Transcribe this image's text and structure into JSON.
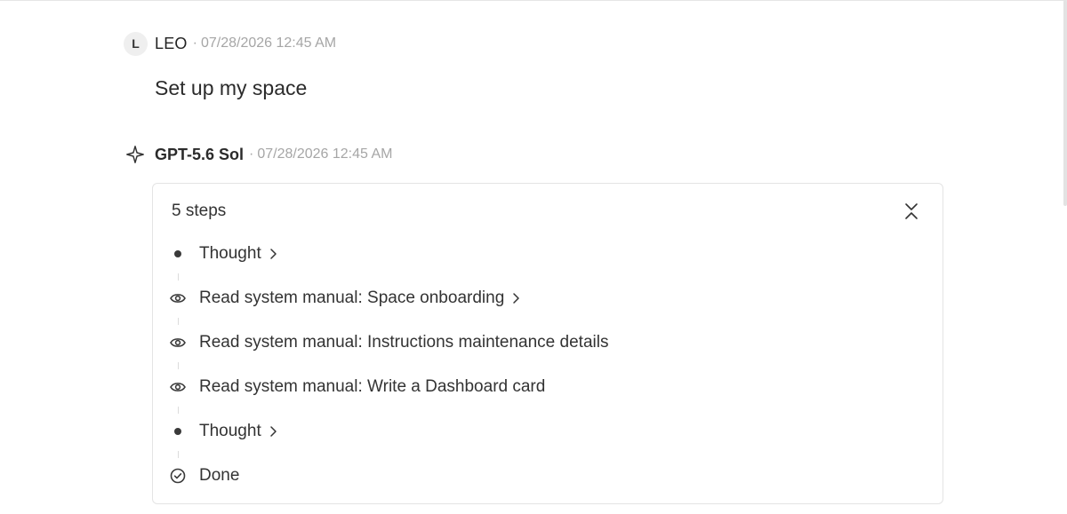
{
  "user_message": {
    "avatar_initial": "L",
    "author": "LEO",
    "separator": "·",
    "timestamp": "07/28/2026 12:45 AM",
    "text": "Set up my space"
  },
  "assistant_message": {
    "model": "GPT-5.6 Sol",
    "separator": "·",
    "timestamp": "07/28/2026 12:45 AM",
    "model_icon": "sparkle-icon"
  },
  "steps": {
    "title": "5 steps",
    "collapse_icon": "collapse-icon",
    "items": [
      {
        "label": "Thought",
        "icon": "bullet-dot-icon",
        "expandable": true
      },
      {
        "label": "Read system manual: Space onboarding",
        "icon": "eye-icon",
        "expandable": true
      },
      {
        "label": "Read system manual: Instructions maintenance details",
        "icon": "eye-icon",
        "expandable": false
      },
      {
        "label": "Read system manual: Write a Dashboard card",
        "icon": "eye-icon",
        "expandable": false
      },
      {
        "label": "Thought",
        "icon": "bullet-dot-icon",
        "expandable": true
      },
      {
        "label": "Done",
        "icon": "check-circle-icon",
        "expandable": false
      }
    ]
  },
  "colors": {
    "text_primary": "#2b2b2b",
    "text_muted": "#a6a6a6",
    "border": "#e4e4e4",
    "avatar_bg": "#efefef"
  }
}
